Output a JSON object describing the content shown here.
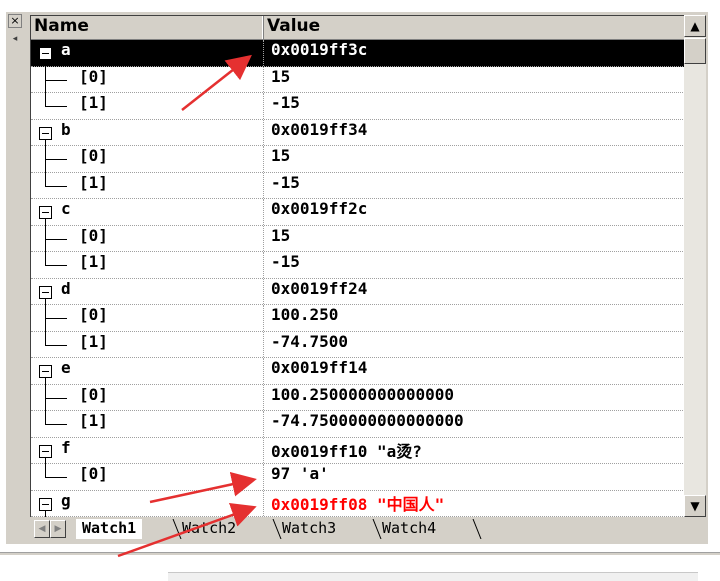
{
  "header": {
    "name_col": "Name",
    "value_col": "Value"
  },
  "rows": [
    {
      "name": "a",
      "value": "0x0019ff3c",
      "depth": 0,
      "selected": true
    },
    {
      "name": "[0]",
      "value": "15",
      "depth": 1
    },
    {
      "name": "[1]",
      "value": "-15",
      "depth": 1,
      "last": true
    },
    {
      "name": "b",
      "value": "0x0019ff34",
      "depth": 0
    },
    {
      "name": "[0]",
      "value": "15",
      "depth": 1
    },
    {
      "name": "[1]",
      "value": "-15",
      "depth": 1,
      "last": true
    },
    {
      "name": "c",
      "value": "0x0019ff2c",
      "depth": 0
    },
    {
      "name": "[0]",
      "value": "15",
      "depth": 1
    },
    {
      "name": "[1]",
      "value": "-15",
      "depth": 1,
      "last": true
    },
    {
      "name": "d",
      "value": "0x0019ff24",
      "depth": 0
    },
    {
      "name": "[0]",
      "value": "100.250",
      "depth": 1
    },
    {
      "name": "[1]",
      "value": "-74.7500",
      "depth": 1,
      "last": true
    },
    {
      "name": "e",
      "value": "0x0019ff14",
      "depth": 0
    },
    {
      "name": "[0]",
      "value": "100.250000000000000",
      "depth": 1
    },
    {
      "name": "[1]",
      "value": "-74.7500000000000000",
      "depth": 1,
      "last": true
    },
    {
      "name": "f",
      "value": "0x0019ff10 \"a烫?",
      "depth": 0
    },
    {
      "name": "[0]",
      "value": "97 'a'",
      "depth": 1,
      "last": true
    },
    {
      "name": "g",
      "value": "0x0019ff08 \"中国人\"",
      "depth": 0,
      "red": true
    }
  ],
  "tabs": [
    {
      "label": "Watch1",
      "active": true
    },
    {
      "label": "Watch2"
    },
    {
      "label": "Watch3"
    },
    {
      "label": "Watch4"
    }
  ],
  "panel": {
    "close_glyph": "×",
    "pin_glyph": "◂"
  },
  "scroll": {
    "up_glyph": "▲",
    "down_glyph": "▼",
    "left_glyph": "◀",
    "right_glyph": "▶"
  },
  "colors": {
    "selection": "#000000",
    "highlight_value": "#ff0000",
    "annotation_arrow": "#e53030"
  }
}
